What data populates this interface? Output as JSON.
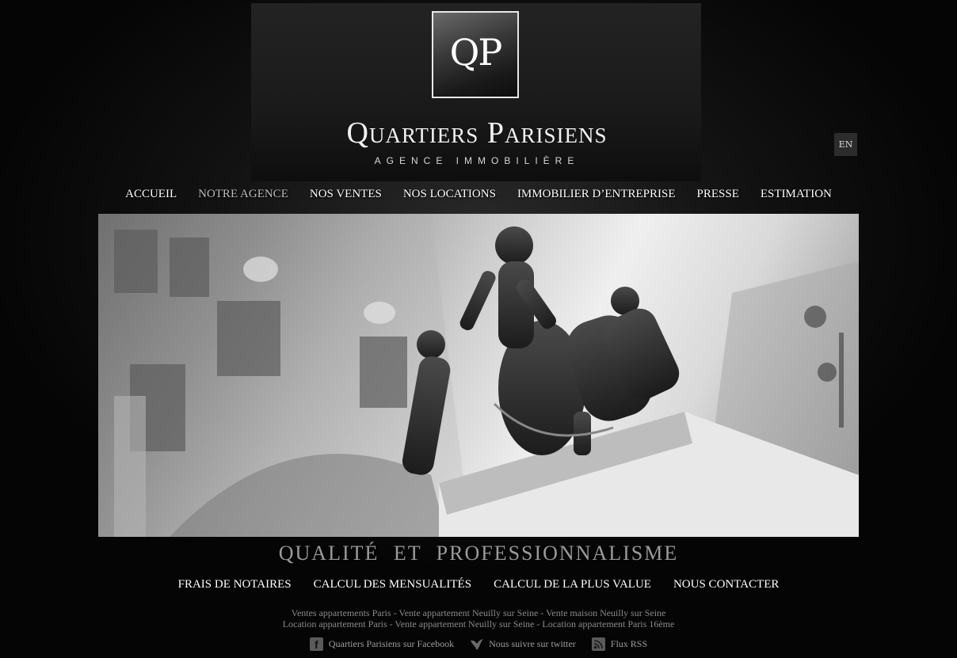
{
  "brand": {
    "monogram": "QP",
    "name": "Quartiers Parisiens",
    "subtitle": "AGENCE IMMOBILIÈRE"
  },
  "language_switch": "EN",
  "main_nav": [
    {
      "label": "ACCUEIL",
      "active": false
    },
    {
      "label": "NOTRE AGENCE",
      "active": true
    },
    {
      "label": "NOS VENTES",
      "active": false
    },
    {
      "label": "NOS LOCATIONS",
      "active": false
    },
    {
      "label": "IMMOBILIER D’ENTREPRISE",
      "active": false
    },
    {
      "label": "PRESSE",
      "active": false
    },
    {
      "label": "ESTIMATION",
      "active": false
    }
  ],
  "tagline": "QUALITÉ ET PROFESSIONNALISME",
  "tools_nav": [
    {
      "label": "FRAIS DE NOTAIRES"
    },
    {
      "label": "CALCUL DES MENSUALITÉS"
    },
    {
      "label": "CALCUL DE LA PLUS VALUE"
    },
    {
      "label": "NOUS CONTACTER"
    }
  ],
  "footer": {
    "seo_line_1": "Ventes appartements Paris - Vente appartement Neuilly sur Seine - Vente maison Neuilly sur Seine",
    "seo_line_2": "Location appartement Paris - Vente appartement Neuilly sur Seine - Location appartement Paris 16ème",
    "social": [
      {
        "icon": "facebook-icon",
        "label": "Quartiers Parisiens sur Facebook"
      },
      {
        "icon": "twitter-bird-icon",
        "label": "Nous suivre sur twitter"
      },
      {
        "icon": "rss-icon",
        "label": "Flux RSS"
      }
    ]
  },
  "colors": {
    "background": "#050505",
    "header_panel": "#1f1f1f",
    "nav_text": "#ffffff",
    "nav_active": "#bdbdbd",
    "tagline": "#9a9a9a",
    "footer_text": "#8a8a8a"
  }
}
